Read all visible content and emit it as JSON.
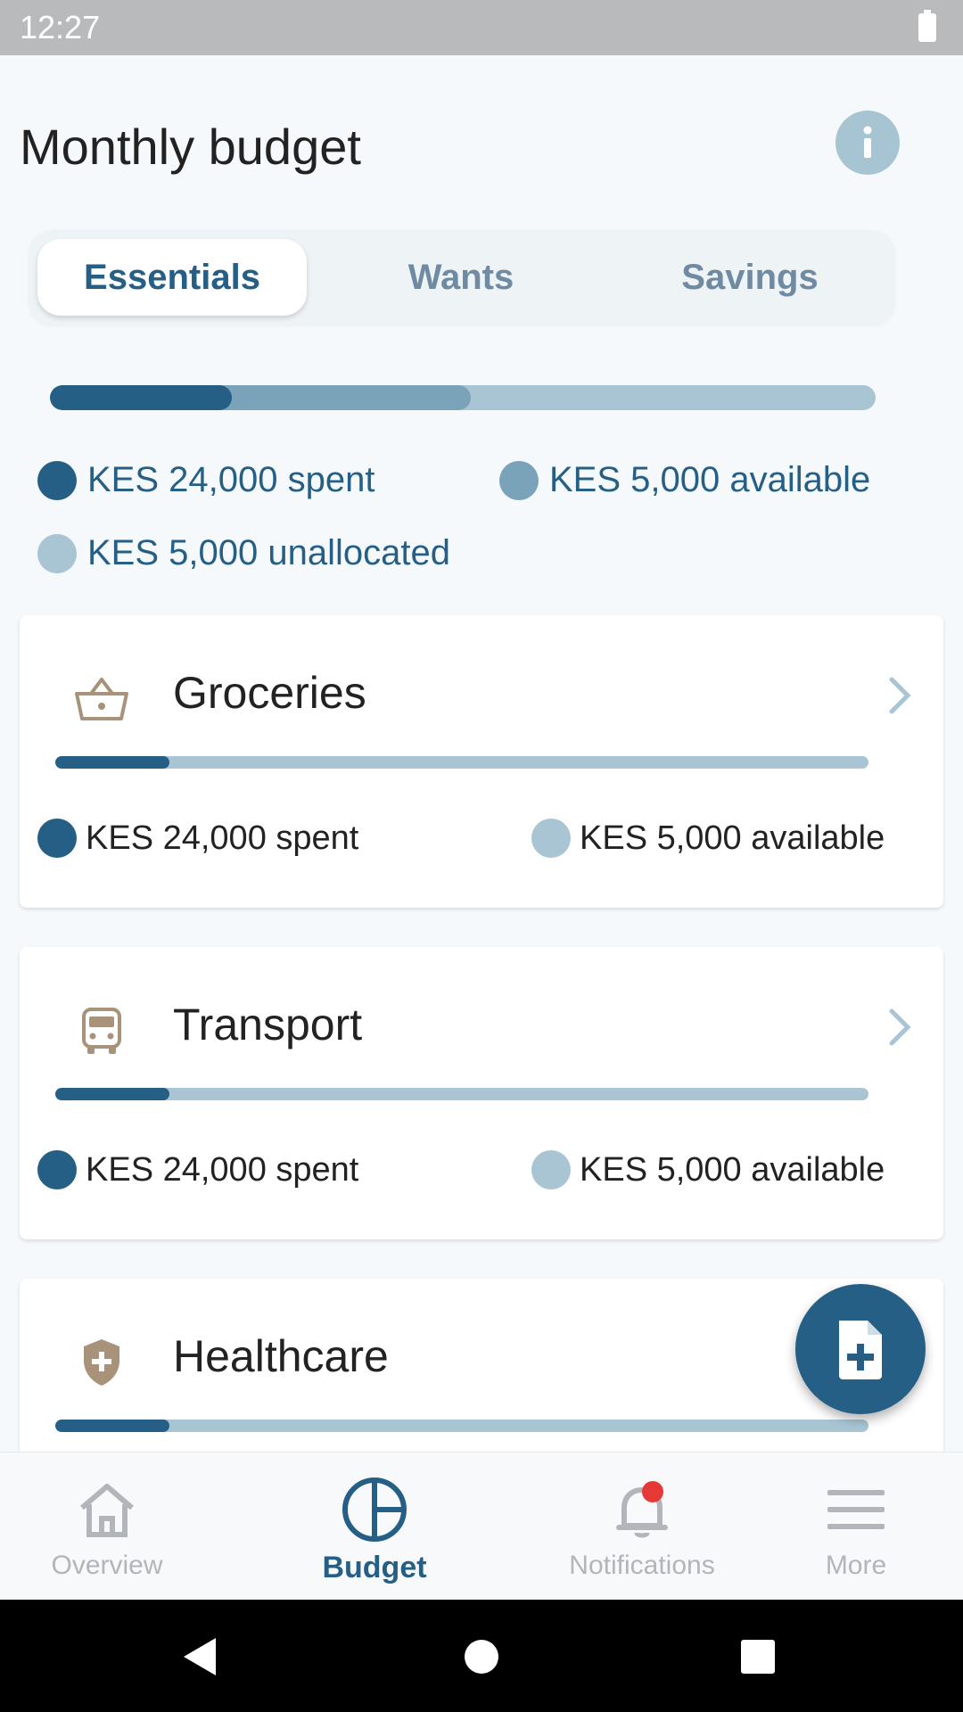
{
  "status_bar": {
    "time": "12:27"
  },
  "header": {
    "title": "Monthly budget",
    "info_icon": "info-icon"
  },
  "tabs": [
    {
      "label": "Essentials",
      "active": true
    },
    {
      "label": "Wants",
      "active": false
    },
    {
      "label": "Savings",
      "active": false
    }
  ],
  "overview": {
    "spent_fraction": 0.22,
    "available_fraction": 0.29,
    "legend": {
      "spent": "KES 24,000 spent",
      "available": "KES 5,000 available",
      "unallocated": "KES 5,000 unallocated"
    }
  },
  "colors": {
    "primary": "#265f85",
    "mid": "#7aa3ba",
    "light": "#a9c5d4",
    "icon_brown": "#a8927a"
  },
  "categories": [
    {
      "name": "Groceries",
      "icon": "basket-icon",
      "spent_fraction": 0.14,
      "spent": "KES 24,000 spent",
      "available": "KES 5,000 available"
    },
    {
      "name": "Transport",
      "icon": "bus-icon",
      "spent_fraction": 0.14,
      "spent": "KES 24,000 spent",
      "available": "KES 5,000 available"
    },
    {
      "name": "Healthcare",
      "icon": "shield-plus-icon",
      "spent_fraction": 0.14
    }
  ],
  "fab": {
    "icon": "add-document-icon"
  },
  "bottom_nav": [
    {
      "label": "Overview",
      "icon": "home-icon",
      "active": false
    },
    {
      "label": "Budget",
      "icon": "pie-chart-icon",
      "active": true
    },
    {
      "label": "Notifications",
      "icon": "bell-icon",
      "active": false,
      "has_badge": true
    },
    {
      "label": "More",
      "icon": "menu-icon",
      "active": false
    }
  ]
}
